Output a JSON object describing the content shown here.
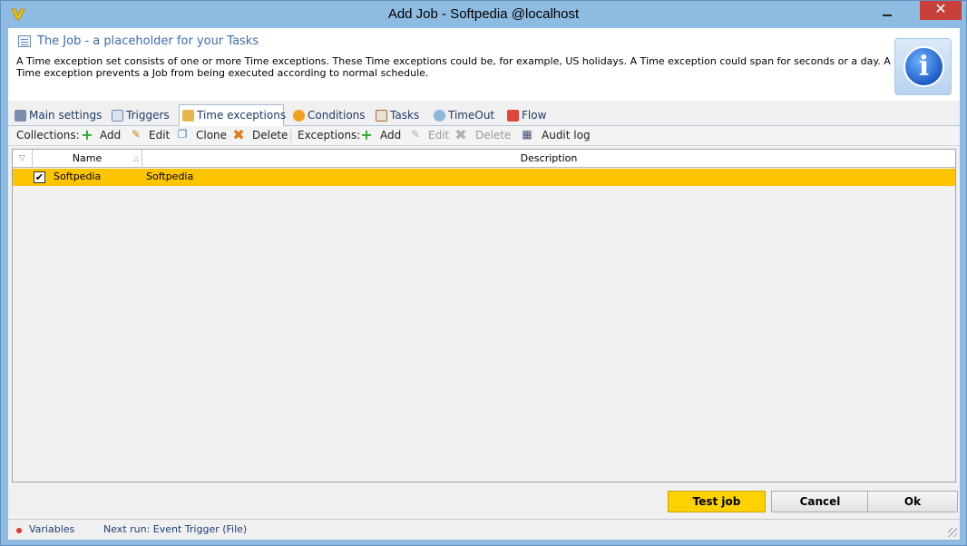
{
  "window": {
    "title": "Add Job - Softpedia @localhost",
    "close_glyph": "✕",
    "colors": {
      "frame": "#8ebbe2",
      "close": "#c7403a",
      "accent": "#fdc400"
    }
  },
  "header": {
    "title": "The Job - a placeholder for your Tasks",
    "description": "A Time exception set consists of one or more Time exceptions. These Time exceptions could be, for example, US holidays. A Time exception could span for seconds or a day. A Time exception prevents a Job from being executed according to normal schedule.",
    "info_glyph": "i"
  },
  "tabs": [
    {
      "label": "Main settings",
      "icon": "gears-icon"
    },
    {
      "label": "Triggers",
      "icon": "calendar-icon"
    },
    {
      "label": "Time exceptions",
      "icon": "hand-icon",
      "active": true
    },
    {
      "label": "Conditions",
      "icon": "question-icon"
    },
    {
      "label": "Tasks",
      "icon": "checklist-icon"
    },
    {
      "label": "TimeOut",
      "icon": "clock-icon"
    },
    {
      "label": "Flow",
      "icon": "flow-icon"
    }
  ],
  "toolbar": {
    "collections_label": "Collections:",
    "add": "Add",
    "edit": "Edit",
    "clone": "Clone",
    "delete": "Delete",
    "exceptions_label": "Exceptions:",
    "ex_add": "Add",
    "ex_edit": "Edit",
    "ex_delete": "Delete",
    "audit_log": "Audit log"
  },
  "grid": {
    "columns": [
      "Name",
      "Description"
    ],
    "filter_glyph": "▽",
    "sort_glyph": "△",
    "rows": [
      {
        "checked": true,
        "check_glyph": "✔",
        "name": "Softpedia",
        "description": "Softpedia"
      }
    ]
  },
  "buttons": {
    "test_job": "Test job",
    "cancel": "Cancel",
    "ok": "Ok"
  },
  "status": {
    "variables": "Variables",
    "next_run": "Next run: Event Trigger (File)"
  }
}
